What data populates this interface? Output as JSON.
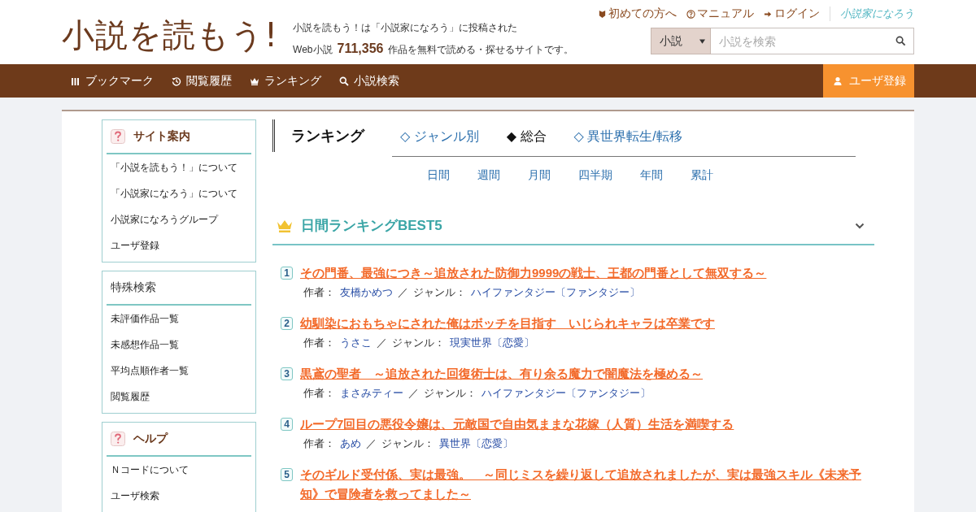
{
  "header": {
    "logo": "小説を読もう!",
    "tagline_1": "小説を読もう！は「小説家になろう」に投稿された",
    "tagline_prefix": "Web小説",
    "work_count": "711,356",
    "tagline_suffix": "作品を無料で読める・探せるサイトです。",
    "top_links": [
      {
        "kind": "beginner",
        "label": "初めての方へ"
      },
      {
        "kind": "manual",
        "label": "マニュアル"
      },
      {
        "kind": "login",
        "label": "ログイン"
      }
    ],
    "partner_logo": "小説家になろう",
    "search": {
      "category": "小説",
      "placeholder": "小説を検索"
    }
  },
  "nav": {
    "items": [
      {
        "kind": "bookmark",
        "label": "ブックマーク"
      },
      {
        "kind": "history",
        "label": "閲覧履歴"
      },
      {
        "kind": "ranking",
        "label": "ランキング"
      },
      {
        "kind": "search",
        "label": "小説検索"
      }
    ],
    "register": "ユーザ登録"
  },
  "sidebar": [
    {
      "title": "サイト案内",
      "help_icon": true,
      "items": [
        "「小説を読もう！」について",
        "「小説家になろう」について",
        "小説家になろうグループ",
        "ユーザ登録"
      ]
    },
    {
      "title": "特殊検索",
      "help_icon": false,
      "items": [
        "未評価作品一覧",
        "未感想作品一覧",
        "平均点順作者一覧",
        "閲覧履歴"
      ]
    },
    {
      "title": "ヘルプ",
      "help_icon": true,
      "items": [
        "Ｎコードについて",
        "ユーザ検索"
      ]
    }
  ],
  "ranking": {
    "title": "ランキング",
    "tabs": [
      {
        "label": "◇ ジャンル別",
        "selected": false
      },
      {
        "label": "◆ 総合",
        "selected": true
      },
      {
        "label": "◇ 異世界転生/転移",
        "selected": false
      }
    ],
    "periods": [
      "日間",
      "週間",
      "月間",
      "四半期",
      "年間",
      "累計"
    ],
    "section_title": "日間ランキングBEST5",
    "entries": [
      {
        "rank": "1",
        "title": "その門番、最強につき～追放された防御力9999の戦士、王都の門番として無双する～",
        "author_label": "作者：",
        "author": "友橋かめつ",
        "separator": "／",
        "genre_label": "ジャンル：",
        "genre": "ハイファンタジー〔ファンタジー〕"
      },
      {
        "rank": "2",
        "title": "幼馴染におもちゃにされた俺はボッチを目指す　いじられキャラは卒業です",
        "author_label": "作者：",
        "author": "うさこ",
        "separator": "／",
        "genre_label": "ジャンル：",
        "genre": "現実世界〔恋愛〕"
      },
      {
        "rank": "3",
        "title": "黒鳶の聖者　～追放された回復術士は、有り余る魔力で闇魔法を極める～",
        "author_label": "作者：",
        "author": "まさみティー",
        "separator": "／",
        "genre_label": "ジャンル：",
        "genre": "ハイファンタジー〔ファンタジー〕"
      },
      {
        "rank": "4",
        "title": "ループ7回目の悪役令嬢は、元敵国で自由気ままな花嫁（人質）生活を満喫する",
        "author_label": "作者：",
        "author": "あめ",
        "separator": "／",
        "genre_label": "ジャンル：",
        "genre": "異世界〔恋愛〕"
      },
      {
        "rank": "5",
        "title": "そのギルド受付係、実は最強。　～同じミスを繰り返して追放されましたが、実は最強スキル《未来予知》で冒険者を救ってました～"
      }
    ]
  }
}
